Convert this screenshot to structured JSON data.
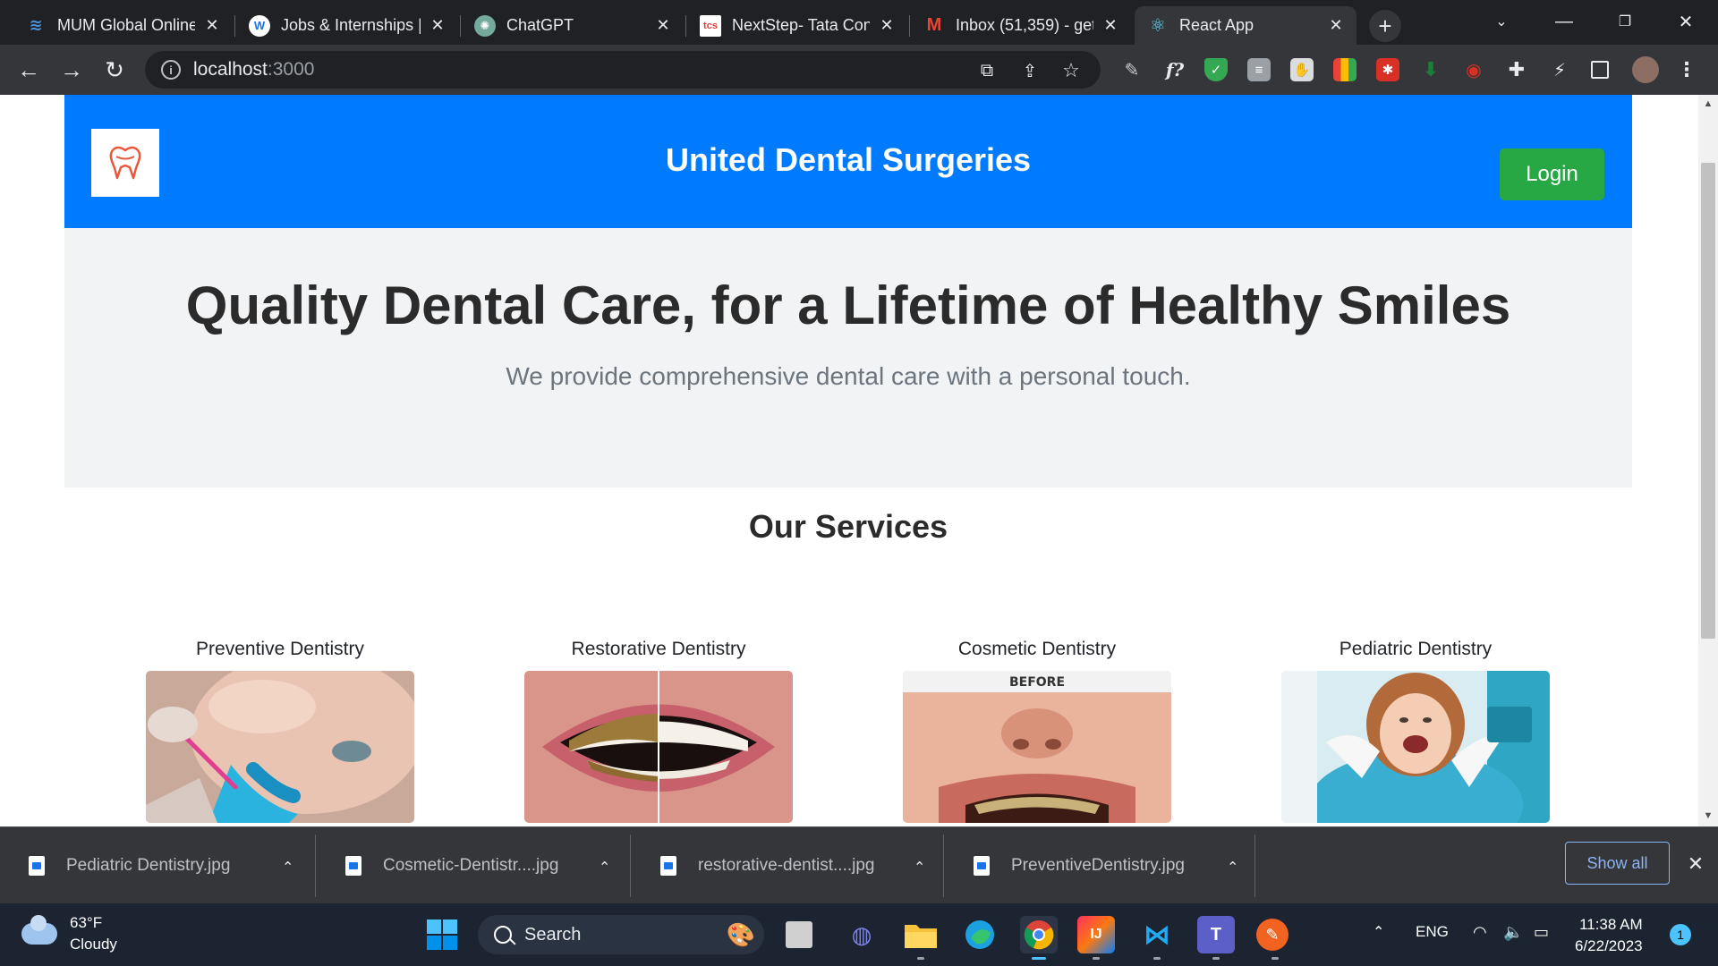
{
  "browser": {
    "tabs": [
      {
        "title": "MUM Global Online",
        "icon": "mum-icon",
        "color": "#4a90d9"
      },
      {
        "title": "Jobs & Internships |",
        "icon": "w-icon",
        "color": "#1a73e8"
      },
      {
        "title": "ChatGPT",
        "icon": "chatgpt-icon",
        "color": "#74aa9c"
      },
      {
        "title": "NextStep- Tata Con",
        "icon": "tcs-icon",
        "color": "#e03a3e"
      },
      {
        "title": "Inbox (51,359) - get",
        "icon": "gmail-icon",
        "color": "#ea4335"
      },
      {
        "title": "React App",
        "icon": "react-icon",
        "color": "#61dafb",
        "active": true
      }
    ],
    "url_host": "localhost",
    "url_port": ":3000"
  },
  "header": {
    "title": "United Dental Surgeries",
    "login_label": "Login"
  },
  "hero": {
    "heading": "Quality Dental Care, for a Lifetime of Healthy Smiles",
    "subheading": "We provide comprehensive dental care with a personal touch."
  },
  "services": {
    "title": "Our Services",
    "items": [
      {
        "title": "Preventive Dentistry"
      },
      {
        "title": "Restorative Dentistry"
      },
      {
        "title": "Cosmetic Dentistry",
        "image_label": "BEFORE"
      },
      {
        "title": "Pediatric Dentistry"
      }
    ]
  },
  "downloads": {
    "items": [
      {
        "name": "Pediatric Dentistry.jpg"
      },
      {
        "name": "Cosmetic-Dentistr....jpg"
      },
      {
        "name": "restorative-dentist....jpg"
      },
      {
        "name": "PreventiveDentistry.jpg"
      }
    ],
    "show_all": "Show all"
  },
  "taskbar": {
    "temperature": "63°F",
    "condition": "Cloudy",
    "search_placeholder": "Search",
    "language": "ENG",
    "time": "11:38 AM",
    "date": "6/22/2023",
    "notification_count": "1"
  },
  "colors": {
    "header_bg": "#007bff",
    "login_bg": "#28a745",
    "hero_bg": "#f1f3f5"
  }
}
